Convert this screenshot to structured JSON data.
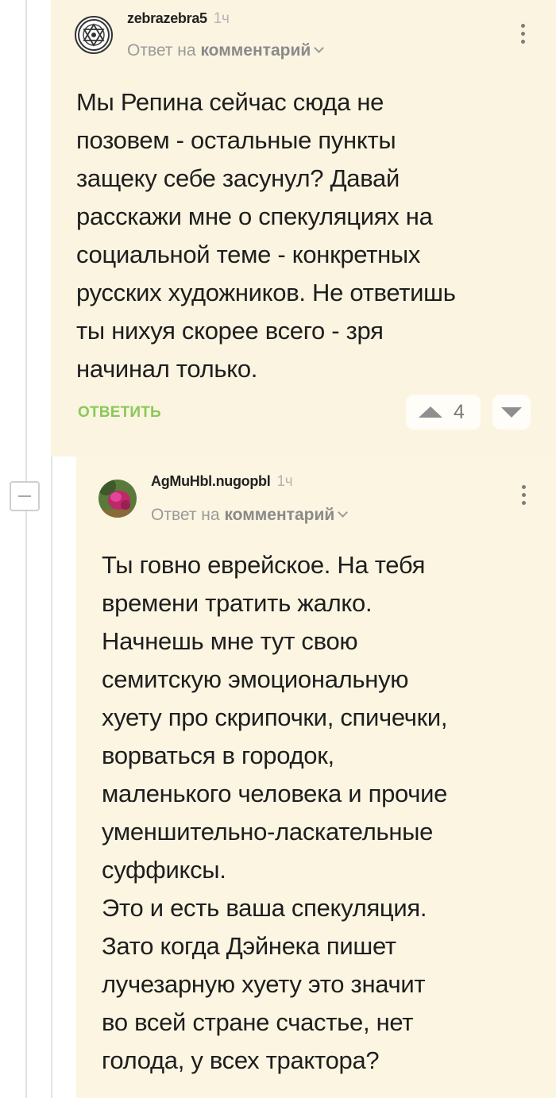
{
  "comments": [
    {
      "username": "zebrazebra5",
      "time": "1ч",
      "reply_prefix": "Ответ на",
      "reply_target": "комментарий",
      "text": "Мы Репина сейчас сюда не\nпозовем - остальные пункты\nзащеку себе засунул? Давай\nрасскажи мне о спекуляциях на\nсоциальной теме - конкретных\nрусских художников. Не ответишь\nты нихуя скорее всего - зря\nначинал только.",
      "reply_label": "ОТВЕТИТЬ",
      "score": "4"
    },
    {
      "username": "AgMuHbl.nugopbl",
      "time": "1ч",
      "reply_prefix": "Ответ на",
      "reply_target": "комментарий",
      "text": "Ты говно еврейское. На тебя\nвремени тратить жалко.\nНачнешь мне тут свою\nсемитскую эмоциональную\nхуету про скрипочки, спичечки,\nворваться в городок,\nмаленького человека и прочие\nуменшительно-ласкательные\nсуффиксы.\nЭто и есть ваша спекуляция.\nЗато когда Дэйнека пишет\nлучезарную хуету это значит\nво всей стране счастье, нет\nголода, у всех трактора?"
    }
  ],
  "colors": {
    "comment_bg": "#fbf4e0",
    "reply_green": "#8ac858",
    "thread_line": "#e3e3e3"
  },
  "icons": {
    "collapse": "minus-icon",
    "more": "vertical-ellipsis-icon",
    "upvote": "triangle-up-icon",
    "downvote": "triangle-down-icon"
  }
}
